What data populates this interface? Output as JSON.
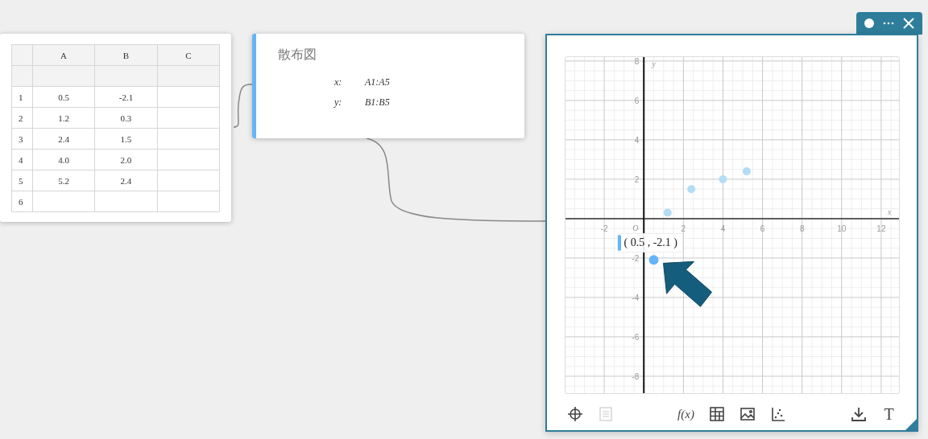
{
  "spreadsheet": {
    "columns": [
      "A",
      "B",
      "C"
    ],
    "rows": [
      {
        "number": "1",
        "cells": [
          "0.5",
          "-2.1"
        ]
      },
      {
        "number": "2",
        "cells": [
          "1.2",
          "0.3"
        ]
      },
      {
        "number": "3",
        "cells": [
          "2.4",
          "1.5"
        ]
      },
      {
        "number": "4",
        "cells": [
          "4.0",
          "2.0"
        ]
      },
      {
        "number": "5",
        "cells": [
          "5.2",
          "2.4"
        ]
      },
      {
        "number": "6"
      }
    ]
  },
  "plot_card": {
    "title": "散布図",
    "params": [
      {
        "name": "x:",
        "value": "A1:A5"
      },
      {
        "name": "y:",
        "value": "B1:B5"
      }
    ]
  },
  "graph_window": {
    "x_axis_label": "x",
    "y_axis_label": "y",
    "origin_label": "O",
    "tooltip": "( 0.5 , -2.1 )",
    "chart_data": {
      "type": "scatter",
      "grid": true,
      "x": [
        0.5,
        1.2,
        2.4,
        4.0,
        5.2
      ],
      "series": [
        {
          "color": "#64b5f6",
          "values": [
            -2.1,
            null,
            null,
            null,
            null
          ]
        },
        {
          "color": "#b3dcf5",
          "values": [
            null,
            0.3,
            1.5,
            2.0,
            2.4
          ]
        }
      ],
      "xlim": [
        -3.96,
        12.9
      ],
      "ylim": [
        -8.86,
        8.2
      ],
      "xticks": [
        -2,
        2,
        4,
        6,
        8,
        10,
        12
      ],
      "yticks": [
        -8,
        -6,
        -4,
        -2,
        2,
        4,
        6,
        8
      ]
    },
    "toolbar": [
      {
        "kind": "crosshair",
        "disabled": false
      },
      {
        "kind": "list",
        "disabled": true
      },
      {
        "kind": "function",
        "label": "f(x)",
        "disabled": false
      },
      {
        "kind": "table",
        "disabled": false
      },
      {
        "kind": "image",
        "disabled": false
      },
      {
        "kind": "scatter",
        "disabled": false
      },
      {
        "kind": "download",
        "disabled": false
      },
      {
        "kind": "text",
        "label": "T",
        "disabled": false
      }
    ]
  }
}
